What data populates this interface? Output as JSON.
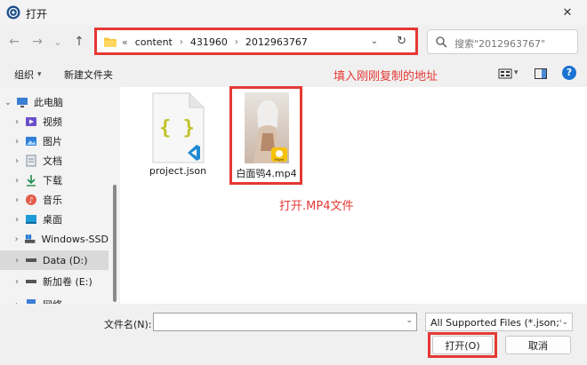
{
  "window": {
    "title": "打开",
    "close_label": "✕"
  },
  "nav": {
    "back": "←",
    "forward": "→",
    "recent": "⌄",
    "up": "↑"
  },
  "address": {
    "lead": "«",
    "crumbs": [
      "content",
      "431960",
      "2012963767"
    ],
    "separator": "›",
    "dropdown": "⌄",
    "refresh": "↻"
  },
  "search": {
    "placeholder": "搜索\"2012963767\""
  },
  "command_bar": {
    "organize": "组织",
    "organize_chevron": "▾",
    "new_folder": "新建文件夹",
    "annotation": "填入刚刚复制的地址",
    "help": "?"
  },
  "sidebar": {
    "items": [
      {
        "label": "此电脑",
        "chevron": "⌄",
        "icon": "computer-icon"
      },
      {
        "label": "视频",
        "chevron": "›",
        "icon": "video-icon"
      },
      {
        "label": "图片",
        "chevron": "›",
        "icon": "picture-icon"
      },
      {
        "label": "文档",
        "chevron": "›",
        "icon": "document-icon"
      },
      {
        "label": "下载",
        "chevron": "›",
        "icon": "download-icon"
      },
      {
        "label": "音乐",
        "chevron": "›",
        "icon": "music-icon"
      },
      {
        "label": "桌面",
        "chevron": "›",
        "icon": "desktop-icon"
      },
      {
        "label": "Windows-SSD",
        "chevron": "›",
        "icon": "drive-icon"
      },
      {
        "label": "Data (D:)",
        "chevron": "›",
        "icon": "drive-icon"
      },
      {
        "label": "新加卷 (E:)",
        "chevron": "›",
        "icon": "drive-icon"
      },
      {
        "label": "网络",
        "chevron": "›",
        "icon": "network-icon"
      }
    ],
    "selected_index": 8
  },
  "files": [
    {
      "name": "project.json",
      "icon": "json-file-icon",
      "glyph": "{ }"
    },
    {
      "name": "白面鸮4.mp4",
      "icon": "video-thumbnail-icon",
      "badge": "Player"
    }
  ],
  "content_annotation": "打开.MP4文件",
  "bottom": {
    "filename_label": "文件名(N):",
    "filename_value": "",
    "filename_dropdown": "⌄",
    "filter_value": "All Supported Files (*.json;*.",
    "filter_dropdown": "⌄",
    "open_button": "打开(O)",
    "cancel_button": "取消"
  },
  "colors": {
    "highlight": "#e53935",
    "accent": "#0067c0",
    "selected_bg": "#d9d9d9"
  }
}
